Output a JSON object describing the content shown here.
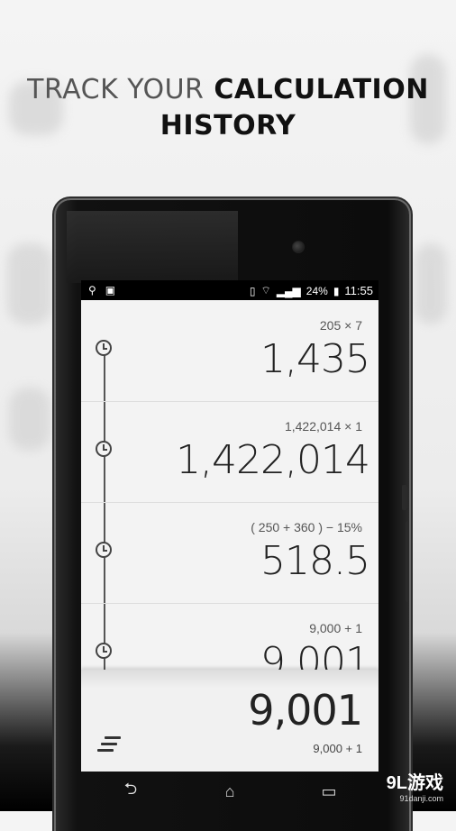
{
  "headline": {
    "light": "TRACK YOUR",
    "bold_line1": "CALCULATION",
    "bold_line2": "HISTORY"
  },
  "statusbar": {
    "battery": "24%",
    "time": "11:55"
  },
  "history": [
    {
      "expression": "205 × 7",
      "result": "1,435"
    },
    {
      "expression": "1,422,014 × 1",
      "result": "1,422,014"
    },
    {
      "expression": "( 250 + 360 ) − 15%",
      "result": "518.5"
    },
    {
      "expression": "9,000 + 1",
      "result": "9,001"
    }
  ],
  "display": {
    "value": "9,001",
    "expression": "9,000  +  1"
  },
  "navbar": {
    "back": "⮌",
    "home": "⌂",
    "recent": "▭"
  },
  "watermark": {
    "brand": "9L游戏",
    "url": "91danji.com"
  }
}
